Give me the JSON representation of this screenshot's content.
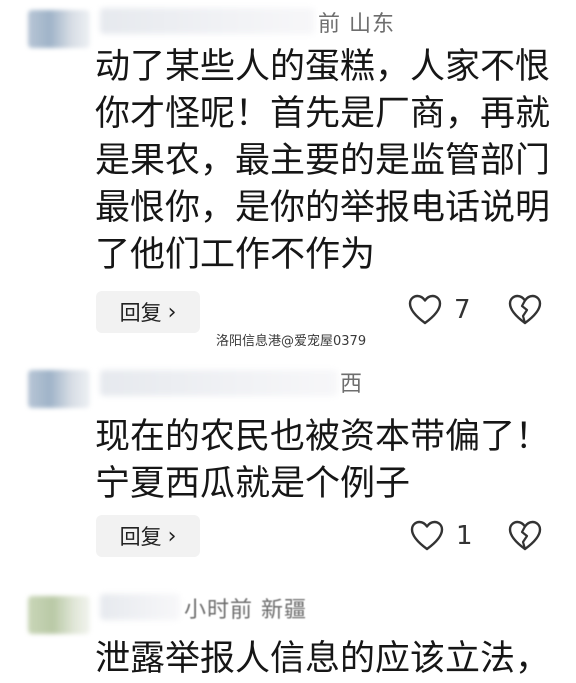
{
  "comments": [
    {
      "meta_location": "前 山东",
      "lines": [
        "动了某些人的蛋糕，人家不恨",
        "你才怪呢！首先是厂商，再就",
        "是果农，最主要的是监管部门",
        "最恨你，是你的举报电话说明",
        "了他们工作不作为"
      ],
      "reply_label": "回复",
      "likes": "7"
    },
    {
      "meta_location": "西",
      "lines": [
        "现在的农民也被资本带偏了！",
        "宁夏西瓜就是个例子"
      ],
      "reply_label": "回复",
      "likes": "1"
    },
    {
      "meta_location": "小时前 新疆",
      "lines": [
        "泄露举报人信息的应该立法，"
      ]
    }
  ],
  "watermark": "洛阳信息港@爱宠屋0379",
  "icons": {
    "chevron": "chevron-right-icon",
    "like": "heart-outline-icon",
    "dislike": "broken-heart-icon"
  }
}
